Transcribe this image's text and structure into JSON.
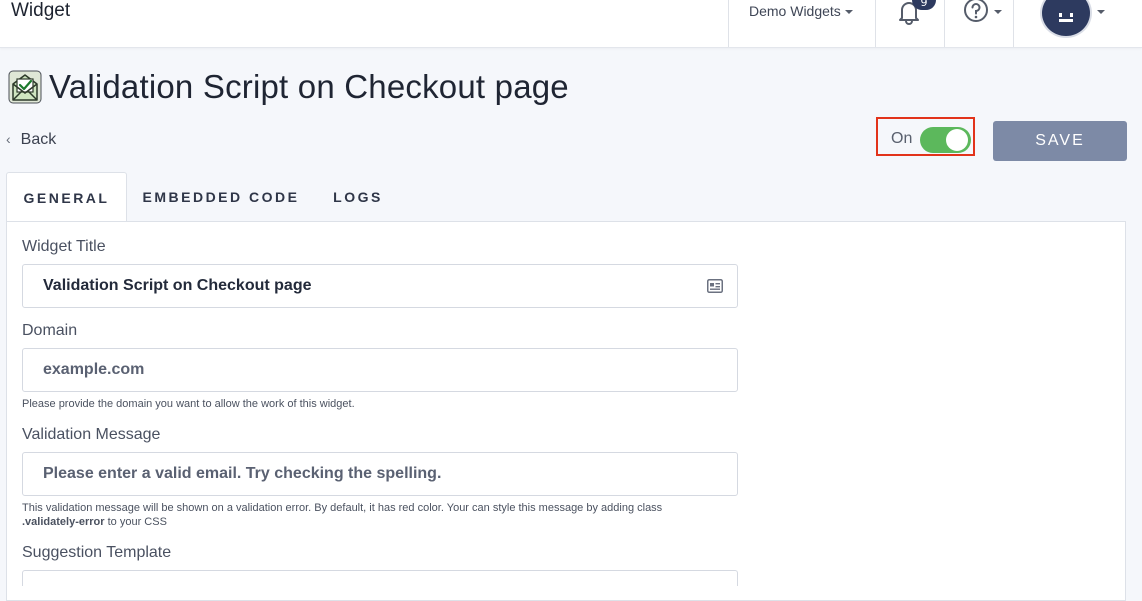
{
  "header": {
    "brand": "Widget",
    "workspace": "Demo Widgets",
    "notifications_count": "9"
  },
  "page": {
    "title": "Validation Script on Checkout page",
    "back_label": "Back",
    "toggle_label": "On",
    "toggle_on": true,
    "save_label": "SAVE"
  },
  "tabs": [
    {
      "label": "GENERAL",
      "active": true
    },
    {
      "label": "EMBEDDED CODE",
      "active": false
    },
    {
      "label": "LOGS",
      "active": false
    }
  ],
  "form": {
    "widget_title": {
      "label": "Widget Title",
      "value": "Validation Script on Checkout page"
    },
    "domain": {
      "label": "Domain",
      "placeholder": "example.com",
      "help": "Please provide the domain you want to allow the work of this widget."
    },
    "validation_message": {
      "label": "Validation Message",
      "placeholder": "Please enter a valid email. Try checking the spelling.",
      "help_prefix": "This validation message will be shown on a validation error. By default, it has red color. Your can style this message by adding class",
      "help_class": ".validately-error",
      "help_suffix": "to your CSS"
    },
    "suggestion_template": {
      "label": "Suggestion Template"
    }
  },
  "colors": {
    "accent_green": "#5cb85c",
    "highlight_red": "#e2331a",
    "save_button": "#7d8aa6",
    "navy": "#2d3a5f"
  }
}
